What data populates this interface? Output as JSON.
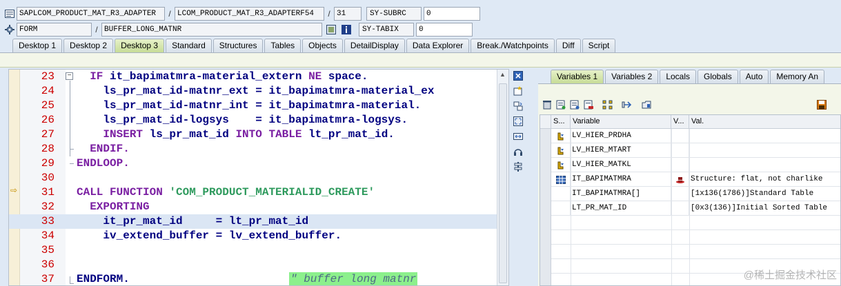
{
  "info": {
    "row1": {
      "program": "SAPLCOM_PRODUCT_MAT_R3_ADAPTER",
      "include": "LCOM_PRODUCT_MAT_R3_ADAPTERF54",
      "line": "31",
      "sysfield_label": "SY-SUBRC",
      "sysfield_value": "0"
    },
    "row2": {
      "event_type": "FORM",
      "event_name": "BUFFER_LONG_MATNR",
      "sysfield_label": "SY-TABIX",
      "sysfield_value": "0"
    }
  },
  "tabs": [
    {
      "label": "Desktop 1"
    },
    {
      "label": "Desktop 2"
    },
    {
      "label": "Desktop 3",
      "active": true
    },
    {
      "label": "Standard"
    },
    {
      "label": "Structures"
    },
    {
      "label": "Tables"
    },
    {
      "label": "Objects"
    },
    {
      "label": "DetailDisplay"
    },
    {
      "label": "Data Explorer"
    },
    {
      "label": "Break./Watchpoints"
    },
    {
      "label": "Diff"
    },
    {
      "label": "Script"
    }
  ],
  "code": {
    "current_line": "31",
    "lines": [
      {
        "no": "23",
        "text": "  IF it_bapimatmra-material_extern NE space."
      },
      {
        "no": "24",
        "text": "    ls_pr_mat_id-matnr_ext = it_bapimatmra-material_ex"
      },
      {
        "no": "25",
        "text": "    ls_pr_mat_id-matnr_int = it_bapimatmra-material."
      },
      {
        "no": "26",
        "text": "    ls_pr_mat_id-logsys    = it_bapimatmra-logsys."
      },
      {
        "no": "27",
        "text": "    INSERT ls_pr_mat_id INTO TABLE lt_pr_mat_id."
      },
      {
        "no": "28",
        "text": "  ENDIF."
      },
      {
        "no": "29",
        "text": "ENDLOOP."
      },
      {
        "no": "30",
        "text": ""
      },
      {
        "no": "31",
        "text": "CALL FUNCTION 'COM_PRODUCT_MATERIALID_CREATE'"
      },
      {
        "no": "32",
        "text": "  EXPORTING"
      },
      {
        "no": "33",
        "text": "    it_pr_mat_id     = lt_pr_mat_id"
      },
      {
        "no": "34",
        "text": "    iv_extend_buffer = lv_extend_buffer."
      },
      {
        "no": "35",
        "text": ""
      },
      {
        "no": "36",
        "text": ""
      },
      {
        "no": "37",
        "text": "ENDFORM.",
        "comment": "\" buffer long matnr"
      }
    ]
  },
  "right_tabs": [
    {
      "label": "Variables 1",
      "active": true
    },
    {
      "label": "Variables 2"
    },
    {
      "label": "Locals"
    },
    {
      "label": "Globals"
    },
    {
      "label": "Auto"
    },
    {
      "label": "Memory An"
    }
  ],
  "variables": {
    "headers": {
      "sel": "S...",
      "variable": "Variable",
      "v": "V...",
      "value": "Val."
    },
    "rows": [
      {
        "icon": "field-icon",
        "name": "LV_HIER_PRDHA",
        "value": ""
      },
      {
        "icon": "field-icon",
        "name": "LV_HIER_MTART",
        "value": ""
      },
      {
        "icon": "field-icon",
        "name": "LV_HIER_MATKL",
        "value": ""
      },
      {
        "icon": "table-icon",
        "name": "IT_BAPIMATMRA",
        "v_icon": "hat-icon",
        "value": "Structure: flat, not charlike"
      },
      {
        "icon": "",
        "name": "IT_BAPIMATMRA[]",
        "value": "[1x136(1786)]Standard Table"
      },
      {
        "icon": "",
        "name": "LT_PR_MAT_ID",
        "value": "[0x3(136)]Initial Sorted Table"
      }
    ]
  },
  "watermark": "@稀土掘金技术社区",
  "colors": {
    "active_tab": "#c7dc97",
    "line_number": "#cc0000",
    "keyword": "#7a1fa2",
    "string": "#2e9a5d",
    "comment_bg": "#8cf08c"
  }
}
